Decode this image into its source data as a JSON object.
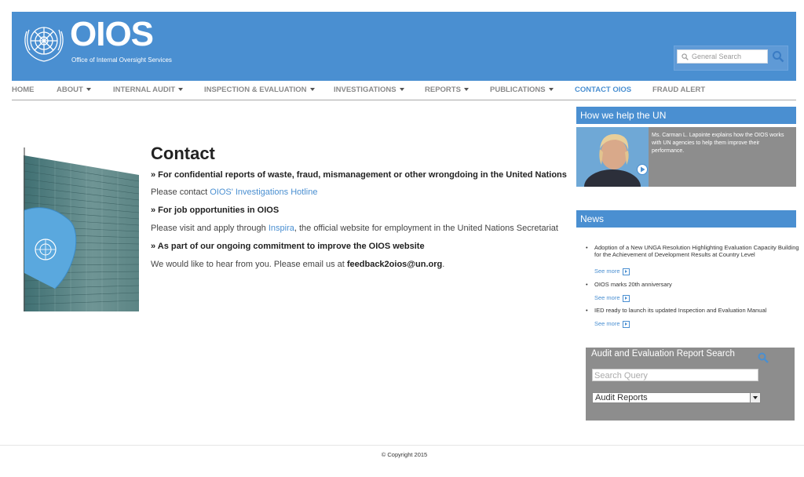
{
  "brand": {
    "logo_text": "OIOS",
    "subtitle": "Office of Internal Oversight Services"
  },
  "header_search": {
    "placeholder": "General Search"
  },
  "nav": {
    "items": [
      {
        "label": "HOME"
      },
      {
        "label": "ABOUT"
      },
      {
        "label": "INTERNAL AUDIT"
      },
      {
        "label": "INSPECTION & EVALUATION"
      },
      {
        "label": "INVESTIGATIONS"
      },
      {
        "label": "REPORTS"
      },
      {
        "label": "PUBLICATIONS"
      },
      {
        "label": "CONTACT OIOS"
      },
      {
        "label": "FRAUD ALERT"
      }
    ],
    "active_color": "#4a8fd1"
  },
  "main": {
    "title": "Contact",
    "section1_heading": "» For confidential reports of waste, fraud, mismanagement or other wrongdoing in the United Nations",
    "section1_text_prefix": "Please contact ",
    "section1_link": "OIOS' Investigations Hotline",
    "section2_heading": "» For job opportunities in OIOS",
    "section2_text_prefix": "Please visit and apply through ",
    "section2_link": "Inspira",
    "section2_text_suffix": ", the official website for employment in the United Nations Secretariat",
    "section3_heading": "» As part of our ongoing commitment to improve the OIOS website",
    "section3_text_prefix": "We would like to hear from you. Please email us at ",
    "section3_email": "feedback2oios@un.org",
    "section3_text_suffix": "."
  },
  "sidebar": {
    "help_heading": "How we help the UN",
    "video_caption": "Ms. Carman L. Lapointe explains how the OIOS works with UN agencies to help them improve their performance.",
    "news_heading": "News",
    "news": [
      {
        "bullet": "•",
        "text": "Adoption of a New UNGA Resolution Highlighting Evaluation Capacity Building",
        "text2": "for the Achievement of Development Results at Country Level",
        "more": "See more"
      },
      {
        "bullet": "•",
        "text": "OIOS marks 20th anniversary",
        "more": "See more"
      },
      {
        "bullet": "•",
        "text": "IED ready to launch its updated Inspection and Evaluation Manual",
        "more": "See more"
      }
    ]
  },
  "report_search": {
    "title": "Audit and Evaluation Report Search",
    "query_placeholder": "Search Query",
    "selected_option": "Audit Reports"
  },
  "footer": {
    "copyright": "© Copyright 2015"
  },
  "colors": {
    "brand_blue": "#4a8fd1",
    "panel_gray": "#8d8d8d"
  }
}
